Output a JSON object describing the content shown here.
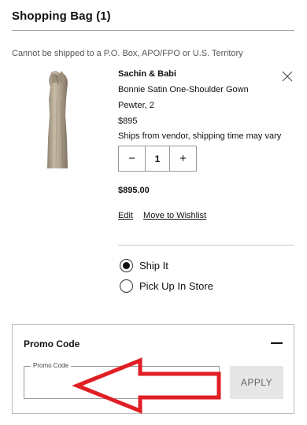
{
  "header": {
    "title": "Shopping Bag (1)"
  },
  "notice": {
    "shipping_restriction": "Cannot be shipped to a P.O. Box, APO/FPO or U.S. Territory"
  },
  "item": {
    "brand": "Sachin & Babi",
    "name": "Bonnie Satin One-Shoulder Gown",
    "variant": "Pewter, 2",
    "price": "$895",
    "shipping_note": "Ships from vendor, shipping time may vary",
    "quantity": "1",
    "decrement_symbol": "−",
    "increment_symbol": "+",
    "total": "$895.00",
    "image_icon": "gown-image",
    "remove_icon": "close-icon"
  },
  "actions": {
    "edit": "Edit",
    "move_to_wishlist": "Move to Wishlist"
  },
  "fulfillment": {
    "options": [
      {
        "label": "Ship It",
        "selected": true
      },
      {
        "label": "Pick Up In Store",
        "selected": false
      }
    ]
  },
  "promo": {
    "title": "Promo Code",
    "field_label": "Promo Code",
    "field_value": "",
    "apply_label": "APPLY",
    "collapse_icon": "minus-icon"
  },
  "colors": {
    "text": "#111111",
    "muted": "#555555",
    "annotation": "#e01e24",
    "button_bg": "#e6e6e6"
  }
}
